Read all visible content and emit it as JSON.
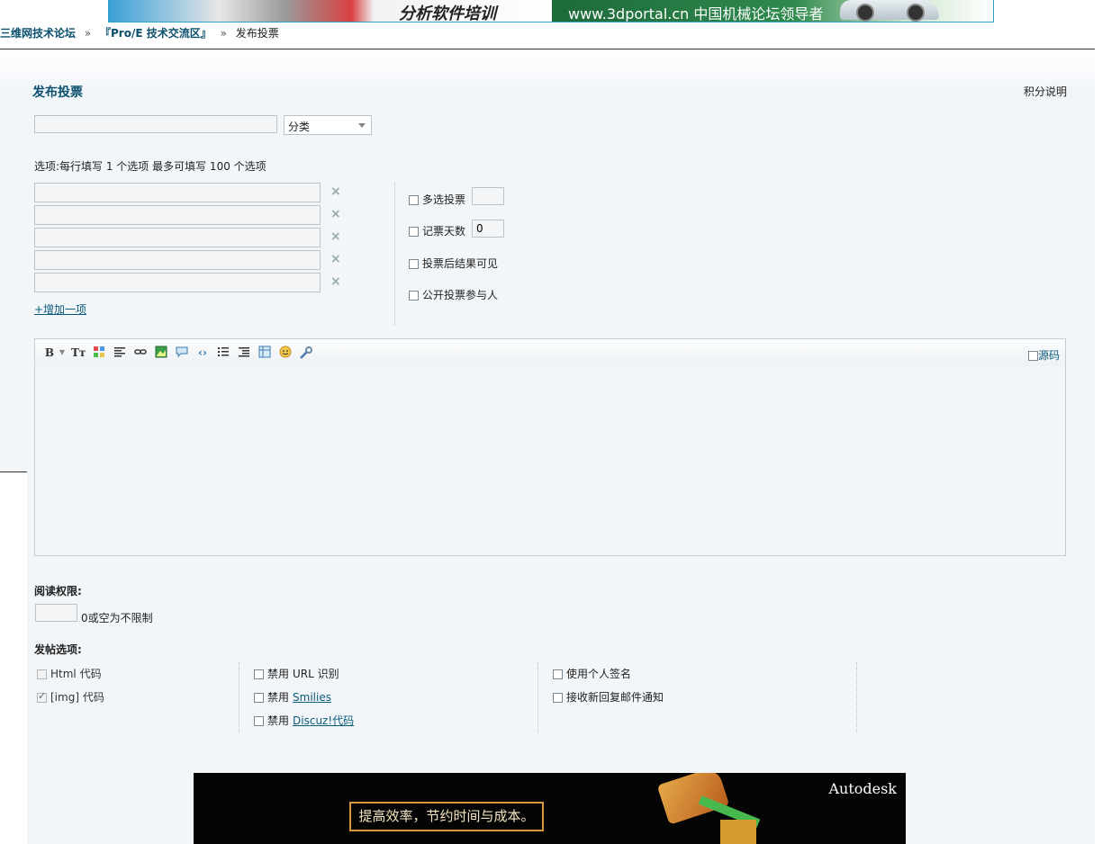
{
  "banner": {
    "left_text": "分析软件培训",
    "right_text": "www.3dportal.cn 中国机械论坛领导者"
  },
  "breadcrumb": {
    "items": [
      "三维网技术论坛",
      "『Pro/E 技术交流区』",
      "发布投票"
    ],
    "separator": "»"
  },
  "page": {
    "title": "发布投票",
    "points_link": "积分说明"
  },
  "subject": {
    "value": "",
    "category_selected": "分类"
  },
  "poll": {
    "options_hint": "选项:每行填写  1 个选项  最多可填写  100 个选项",
    "option_values": [
      "",
      "",
      "",
      "",
      ""
    ],
    "delete_glyph": "×",
    "add_option_label": "+增加一项",
    "settings": {
      "multi_label": "多选投票",
      "multi_value": "",
      "days_label": "记票天数",
      "days_value": "0",
      "visible_after_label": "投票后结果可见",
      "public_voters_label": "公开投票参与人"
    }
  },
  "editor": {
    "tools": [
      "bold-icon",
      "text-size-icon",
      "color-icon",
      "align-icon",
      "link-icon",
      "image-icon",
      "quote-icon",
      "code-icon",
      "list-icon",
      "indent-icon",
      "table-icon",
      "smiley-icon",
      "wrench-icon"
    ],
    "source_label": "源码"
  },
  "permission": {
    "label": "阅读权限:",
    "value": "",
    "hint": "0或空为不限制"
  },
  "post_options": {
    "label": "发帖选项:",
    "html_label": "Html 代码",
    "img_label": "[img] 代码",
    "disable_prefix": "禁用",
    "url_label": "URL 识别",
    "smilies_label": "Smilies",
    "discuz_label": "Discuz!代码",
    "signature_label": "使用个人签名",
    "email_notify_label": "接收新回复邮件通知"
  },
  "ad_bottom": {
    "slogan": "提高效率，节约时间与成本。",
    "brand": "Autodesk"
  },
  "colors": {
    "accent": "#0a4f6e",
    "link": "#0a5a7a",
    "panel": "#f2f6f9"
  }
}
